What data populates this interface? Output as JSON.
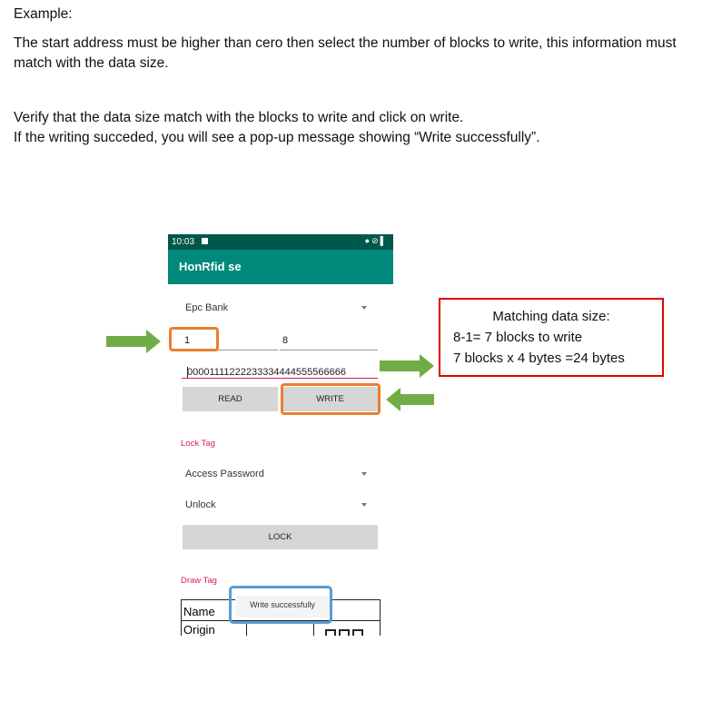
{
  "document": {
    "heading": "Example:",
    "paragraph1": "The start address must be higher than cero then select the number of blocks to write, this information must match with the data size.",
    "paragraph2_line1": "Verify that the data size match with the blocks to write and click on write.",
    "paragraph2_line2": "If the writing succeded, you will see a pop-up message showing “Write successfully”."
  },
  "phone": {
    "status_time": "10:03",
    "status_icons": "●⊘▌",
    "app_title": "HonRfid se",
    "bank_select": "Epc Bank",
    "start_address": "1",
    "end_block": "8",
    "data_value": "00001111222233334444555566666",
    "read_button": "READ",
    "write_button": "WRITE",
    "lock_section_label": "Lock Tag",
    "password_select": "Access Password",
    "lock_mode_select": "Unlock",
    "lock_button": "LOCK",
    "draw_section_label": "Draw Tag",
    "table_name": "Name",
    "table_origin": "Origin",
    "toast": "Write successfully"
  },
  "callout": {
    "line1": "Matching data size:",
    "line2": "8-1= 7 blocks to write",
    "line3": "7 blocks x 4 bytes =24 bytes"
  },
  "colors": {
    "highlight_orange": "#ed7d31",
    "highlight_blue": "#5b9bd5",
    "arrow_green": "#70ad47",
    "callout_border": "#e00000",
    "app_bar": "#00897b",
    "status_bar": "#00574b"
  }
}
